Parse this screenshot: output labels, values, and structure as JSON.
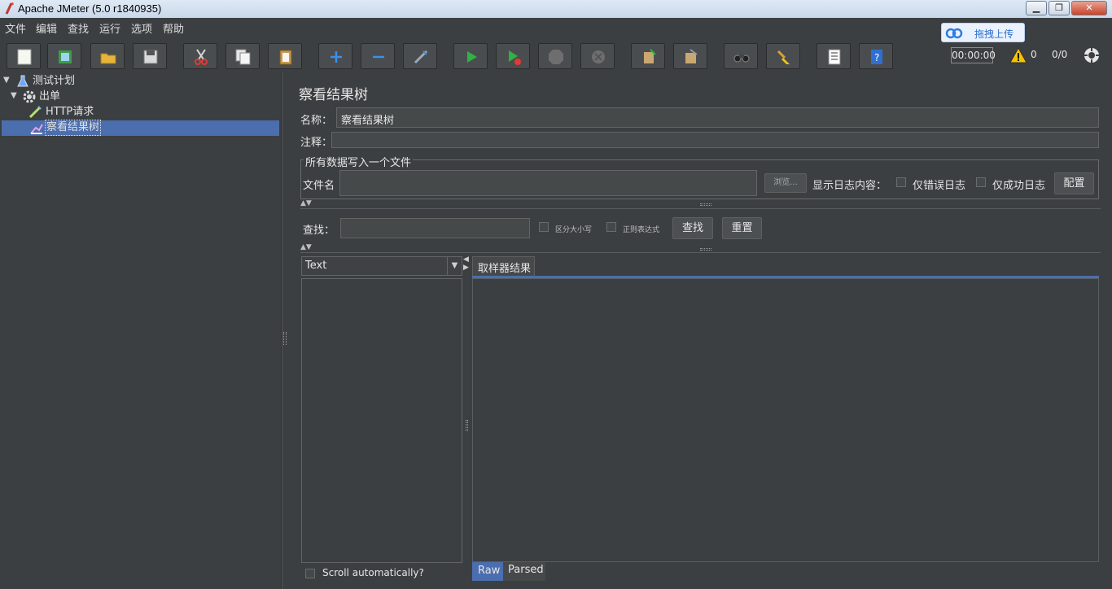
{
  "window": {
    "title": "Apache JMeter (5.0 r1840935)",
    "minimize": "▁",
    "maximize": "❐",
    "close": "✕"
  },
  "menu": [
    "文件",
    "编辑",
    "查找",
    "运行",
    "选项",
    "帮助"
  ],
  "upload_badge": {
    "label": "拖拽上传"
  },
  "status": {
    "timer": "00:00:00",
    "warnings": "0",
    "threads": "0/0"
  },
  "tree": {
    "items": [
      {
        "label": "测试计划"
      },
      {
        "label": "出单"
      },
      {
        "label": "HTTP请求"
      },
      {
        "label": "察看结果树"
      }
    ]
  },
  "panel": {
    "title": "察看结果树",
    "name_label": "名称：",
    "name_value": "察看结果树",
    "comment_label": "注释：",
    "comment_value": "",
    "file_group_title": "所有数据写入一个文件",
    "file_label": "文件名",
    "file_value": "",
    "browse_button": "浏览...",
    "log_label": "显示日志内容：",
    "errors_only": "仅错误日志",
    "success_only": "仅成功日志",
    "configure_button": "配置"
  },
  "search": {
    "label": "查找：",
    "value": "",
    "case_sensitive": "区分大小写",
    "regex": "正则表达式",
    "find_button": "查找",
    "reset_button": "重置"
  },
  "renderer": {
    "selected": "Text"
  },
  "results": {
    "tab": "取样器结果",
    "scroll_auto": "Scroll automatically?",
    "bottom_tabs": [
      "Raw",
      "Parsed"
    ]
  },
  "colors": {
    "background": "#3c3f41",
    "selection": "#4b6eaf",
    "accent_blue": "#3b8ee8"
  }
}
